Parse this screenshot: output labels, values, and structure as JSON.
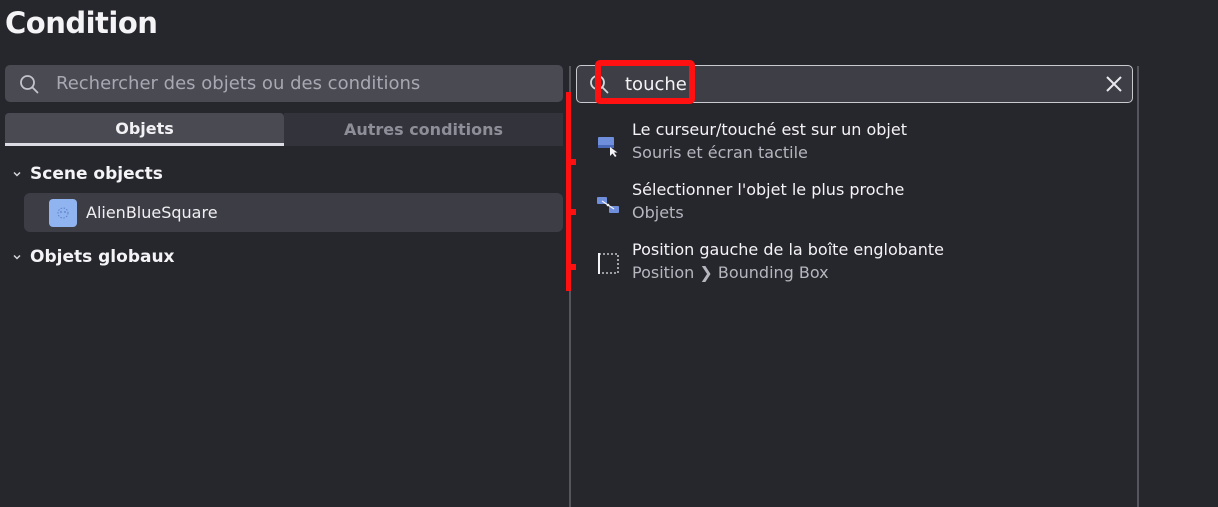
{
  "dialog": {
    "title": "Condition"
  },
  "left_panel": {
    "search_placeholder": "Rechercher des objets ou des conditions",
    "tabs": [
      {
        "label": "Objets",
        "active": true
      },
      {
        "label": "Autres conditions",
        "active": false
      }
    ],
    "groups": [
      {
        "label": "Scene objects",
        "expanded": true,
        "items": [
          {
            "label": "AlienBlueSquare",
            "selected": true
          }
        ]
      },
      {
        "label": "Objets globaux",
        "expanded": true,
        "items": []
      }
    ]
  },
  "right_panel": {
    "search_value": "touche",
    "results": [
      {
        "title": "Le curseur/touché est sur un objet",
        "subtitle": "Souris et écran tactile",
        "icon": "cursor-on-object-icon"
      },
      {
        "title": "Sélectionner l'objet le plus proche",
        "subtitle": "Objets",
        "icon": "nearest-object-icon"
      },
      {
        "title": "Position gauche de la boîte englobante",
        "subtitle": "Position ❯ Bounding Box",
        "icon": "bounding-box-icon"
      }
    ]
  },
  "colors": {
    "background": "#26262d",
    "panel": "#4a4a53",
    "annotation": "#ff1111",
    "object_icon": "#8fb4f0"
  }
}
